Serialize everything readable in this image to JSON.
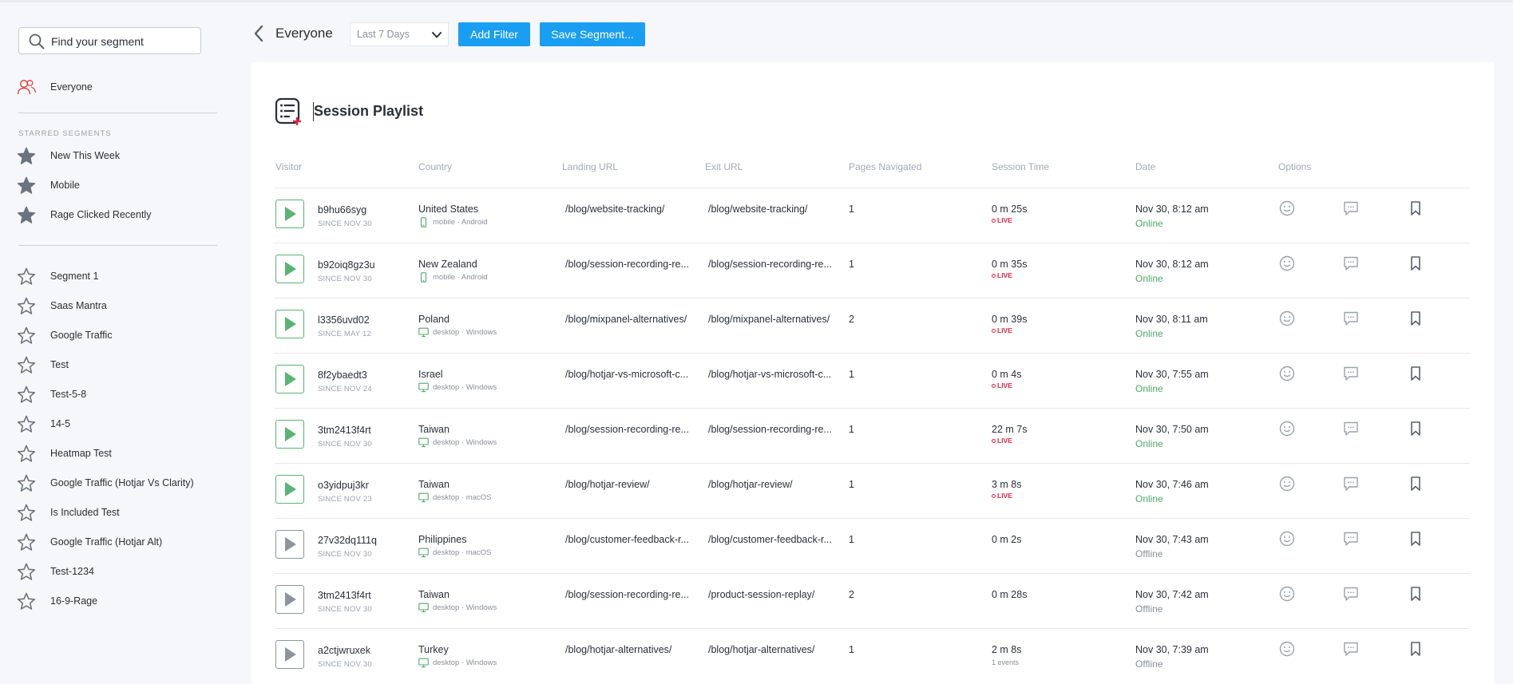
{
  "search": {
    "placeholder": "Find your segment"
  },
  "sidebar": {
    "everyone": "Everyone",
    "starred_title": "STARRED SEGMENTS",
    "starred": [
      "New This Week",
      "Mobile",
      "Rage Clicked Recently"
    ],
    "segments": [
      "Segment 1",
      "Saas Mantra",
      "Google Traffic",
      "Test",
      "Test-5-8",
      "14-5",
      "Heatmap Test",
      "Google Traffic (Hotjar Vs Clarity)",
      "Is Included Test",
      "Google Traffic (Hotjar Alt)",
      "Test-1234",
      "16-9-Rage"
    ]
  },
  "topbar": {
    "segment": "Everyone",
    "range": "Last 7 Days",
    "add_filter": "Add Filter",
    "save_segment": "Save Segment..."
  },
  "panel": {
    "title": "Session Playlist",
    "columns": [
      "Visitor",
      "Country",
      "Landing URL",
      "Exit URL",
      "Pages Navigated",
      "Session Time",
      "Date",
      "Options"
    ]
  },
  "live_label": "LIVE",
  "rows": [
    {
      "visitor": "b9hu66syg",
      "since": "SINCE NOV 30",
      "country": "United States",
      "device": "mobile · Android",
      "device_icon": "mobile-icon",
      "landing": "/blog/website-tracking/",
      "exit": "/blog/website-tracking/",
      "pages": "1",
      "time": "0 m 25s",
      "extra": "",
      "date": "Nov 30, 8:12 am",
      "status": "Online"
    },
    {
      "visitor": "b92oiq8gz3u",
      "since": "SINCE NOV 30",
      "country": "New Zealand",
      "device": "mobile · Android",
      "device_icon": "mobile-icon",
      "landing": "/blog/session-recording-re...",
      "exit": "/blog/session-recording-re...",
      "pages": "1",
      "time": "0 m 35s",
      "extra": "",
      "date": "Nov 30, 8:12 am",
      "status": "Online"
    },
    {
      "visitor": "l3356uvd02",
      "since": "SINCE MAY 12",
      "country": "Poland",
      "device": "desktop · Windows",
      "device_icon": "desktop-icon",
      "landing": "/blog/mixpanel-alternatives/",
      "exit": "/blog/mixpanel-alternatives/",
      "pages": "2",
      "time": "0 m 39s",
      "extra": "",
      "date": "Nov 30, 8:11 am",
      "status": "Online"
    },
    {
      "visitor": "8f2ybaedt3",
      "since": "SINCE NOV 24",
      "country": "Israel",
      "device": "desktop · Windows",
      "device_icon": "desktop-icon",
      "landing": "/blog/hotjar-vs-microsoft-c...",
      "exit": "/blog/hotjar-vs-microsoft-c...",
      "pages": "1",
      "time": "0 m 4s",
      "extra": "",
      "date": "Nov 30, 7:55 am",
      "status": "Online"
    },
    {
      "visitor": "3tm2413f4rt",
      "since": "SINCE NOV 30",
      "country": "Taiwan",
      "device": "desktop · Windows",
      "device_icon": "desktop-icon",
      "landing": "/blog/session-recording-re...",
      "exit": "/blog/session-recording-re...",
      "pages": "1",
      "time": "22 m 7s",
      "extra": "",
      "date": "Nov 30, 7:50 am",
      "status": "Online"
    },
    {
      "visitor": "o3yidpuj3kr",
      "since": "SINCE NOV 23",
      "country": "Taiwan",
      "device": "desktop · macOS",
      "device_icon": "desktop-icon",
      "landing": "/blog/hotjar-review/",
      "exit": "/blog/hotjar-review/",
      "pages": "1",
      "time": "3 m 8s",
      "extra": "",
      "date": "Nov 30, 7:46 am",
      "status": "Online"
    },
    {
      "visitor": "27v32dq111q",
      "since": "SINCE NOV 30",
      "country": "Philippines",
      "device": "desktop · macOS",
      "device_icon": "desktop-icon",
      "landing": "/blog/customer-feedback-r...",
      "exit": "/blog/customer-feedback-r...",
      "pages": "1",
      "time": "0 m 2s",
      "extra": "",
      "date": "Nov 30, 7:43 am",
      "status": "Offline"
    },
    {
      "visitor": "3tm2413f4rt",
      "since": "SINCE NOV 30",
      "country": "Taiwan",
      "device": "desktop · Windows",
      "device_icon": "desktop-icon",
      "landing": "/blog/session-recording-re...",
      "exit": "/product-session-replay/",
      "pages": "2",
      "time": "0 m 28s",
      "extra": "",
      "date": "Nov 30, 7:42 am",
      "status": "Offline"
    },
    {
      "visitor": "a2ctjwruxek",
      "since": "SINCE NOV 30",
      "country": "Turkey",
      "device": "desktop · Windows",
      "device_icon": "desktop-icon",
      "landing": "/blog/hotjar-alternatives/",
      "exit": "/blog/hotjar-alternatives/",
      "pages": "1",
      "time": "2 m 8s",
      "extra": "1 events",
      "date": "Nov 30, 7:39 am",
      "status": "Offline"
    }
  ],
  "colors": {
    "accent": "#1a9ef2",
    "online": "#4fa96a",
    "live": "#e8243b",
    "play_live": "#5bb374",
    "play_offline": "#8e949f"
  }
}
